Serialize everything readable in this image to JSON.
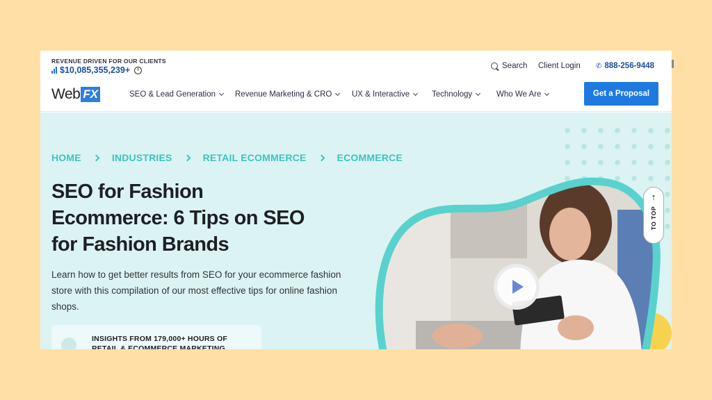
{
  "topbar": {
    "revenue_label": "REVENUE DRIVEN FOR OUR CLIENTS",
    "revenue_value": "$10,085,355,239+",
    "search_label": "Search",
    "login_label": "Client Login",
    "phone": "888-256-9448"
  },
  "logo": {
    "web": "Web",
    "fx": "FX"
  },
  "nav": {
    "items": [
      {
        "label": "SEO & Lead Generation"
      },
      {
        "label": "Revenue Marketing & CRO"
      },
      {
        "label": "UX & Interactive"
      },
      {
        "label": "Technology"
      },
      {
        "label": "Who We Are"
      }
    ],
    "cta_label": "Get a Proposal"
  },
  "breadcrumb": [
    "HOME",
    "INDUSTRIES",
    "RETAIL ECOMMERCE",
    "ECOMMERCE"
  ],
  "hero": {
    "title_lines": [
      "SEO for Fashion",
      "Ecommerce: 6 Tips on SEO",
      "for Fashion Brands"
    ],
    "description": "Learn how to get better results from SEO for your ecommerce fashion store with this compilation of our most effective tips for online fashion shops.",
    "insights_lines": [
      "INSIGHTS FROM 179,000+ HOURS OF",
      "RETAIL & ECOMMERCE MARKETING"
    ]
  },
  "totop": {
    "arrow": "↑",
    "label": "TO TOP"
  },
  "colors": {
    "background": "#ffdfa6",
    "brand_blue": "#1f7ae0",
    "teal": "#3cc3be",
    "hero_bg": "#dcf3f3"
  },
  "icons": [
    "bar-chart-icon",
    "info-icon",
    "search-icon",
    "phone-icon",
    "chevron-down-icon",
    "chevron-right-icon",
    "play-icon",
    "arrow-up-icon"
  ]
}
